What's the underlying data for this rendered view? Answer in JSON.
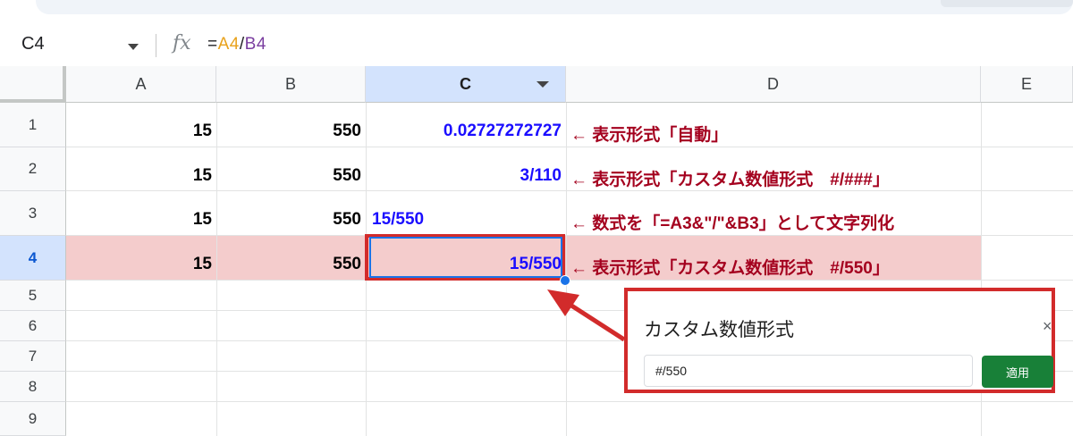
{
  "formula_bar": {
    "name_box": "C4",
    "fx_icon": "fx-icon",
    "formula_prefix": "=",
    "ref1": "A4",
    "separator": "/",
    "ref2": "B4"
  },
  "columns": [
    "A",
    "B",
    "C",
    "D",
    "E"
  ],
  "selected_column": "C",
  "rows": [
    "1",
    "2",
    "3",
    "4",
    "5",
    "6",
    "7",
    "8",
    "9"
  ],
  "selected_row": "4",
  "cells": [
    {
      "a": "15",
      "b": "550",
      "c": "0.02727272727",
      "d": "← 表示形式「自動」"
    },
    {
      "a": "15",
      "b": "550",
      "c": "3/110",
      "d": "← 表示形式「カスタム数値形式　#/###」"
    },
    {
      "a": "15",
      "b": "550",
      "c": "15/550",
      "d": "← 数式を「=A3&\"/\"&B3」として文字列化"
    },
    {
      "a": "15",
      "b": "550",
      "c": "15/550",
      "d": "← 表示形式「カスタム数値形式　#/550」"
    }
  ],
  "popup": {
    "title": "カスタム数値形式",
    "close": "×",
    "input_value": "#/550",
    "apply_label": "適用"
  },
  "colors": {
    "highlight_row": "#f4cccc",
    "annotation_red": "#a4001e",
    "value_blue": "#1a0dff",
    "callout_red": "#d22b2b",
    "apply_green": "#188038"
  }
}
